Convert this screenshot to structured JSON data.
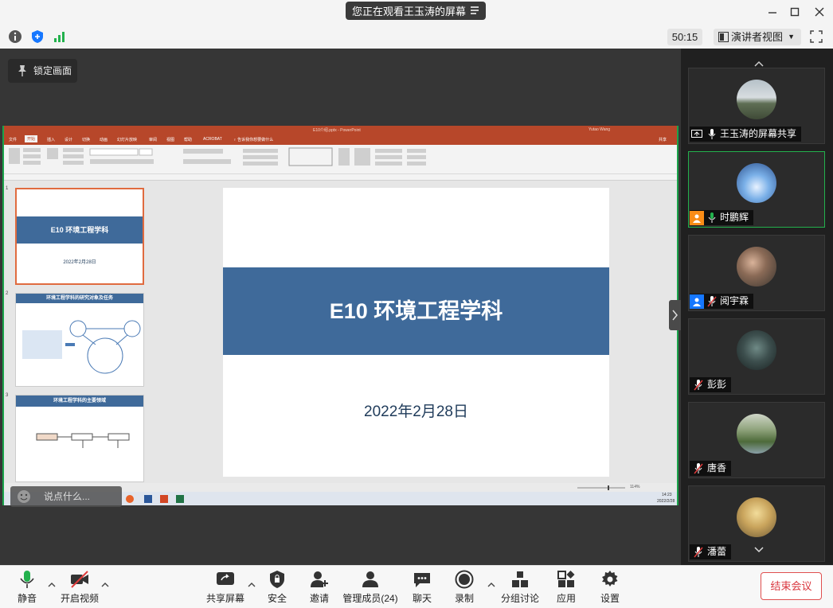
{
  "titlebar": {
    "sharing_banner": "您正在观看王玉涛的屏幕"
  },
  "toprow": {
    "timer": "50:15",
    "view_mode": "演讲者视图"
  },
  "main": {
    "lock_label": "锁定画面",
    "chat_placeholder": "说点什么..."
  },
  "ppt": {
    "file_title": "E10介绍.pptx - PowerPoint",
    "user": "Yutao Wang",
    "tabs": [
      "文件",
      "开始",
      "插入",
      "设计",
      "切换",
      "动画",
      "幻灯片放映",
      "审阅",
      "视图",
      "帮助",
      "ACROBAT",
      "♀ 告诉我你想要做什么"
    ],
    "share": "共享",
    "slide_title": "E10 环境工程学科",
    "slide_date": "2022年2月28日",
    "thumb2_title": "环境工程学科的研究对象及任务",
    "thumb3_title": "环境工程学科的主要领域",
    "zoom": "114%",
    "clock": "14:23",
    "clock_date": "2022/2/28"
  },
  "participants": [
    {
      "name": "王玉涛的屏幕共享",
      "mic": "on",
      "badge": "share"
    },
    {
      "name": "时鹏辉",
      "mic": "on",
      "badge": "orange",
      "speaking": true
    },
    {
      "name": "阅宇霖",
      "mic": "muted",
      "badge": "blue"
    },
    {
      "name": "彭彭",
      "mic": "muted"
    },
    {
      "name": "唐香",
      "mic": "muted"
    },
    {
      "name": "潘蕾",
      "mic": "muted"
    }
  ],
  "toolbar": {
    "mute": "静音",
    "video": "开启视频",
    "share": "共享屏幕",
    "security": "安全",
    "invite": "邀请",
    "members": "管理成员(24)",
    "chat": "聊天",
    "record": "录制",
    "breakout": "分组讨论",
    "apps": "应用",
    "settings": "设置",
    "end": "结束会议"
  }
}
